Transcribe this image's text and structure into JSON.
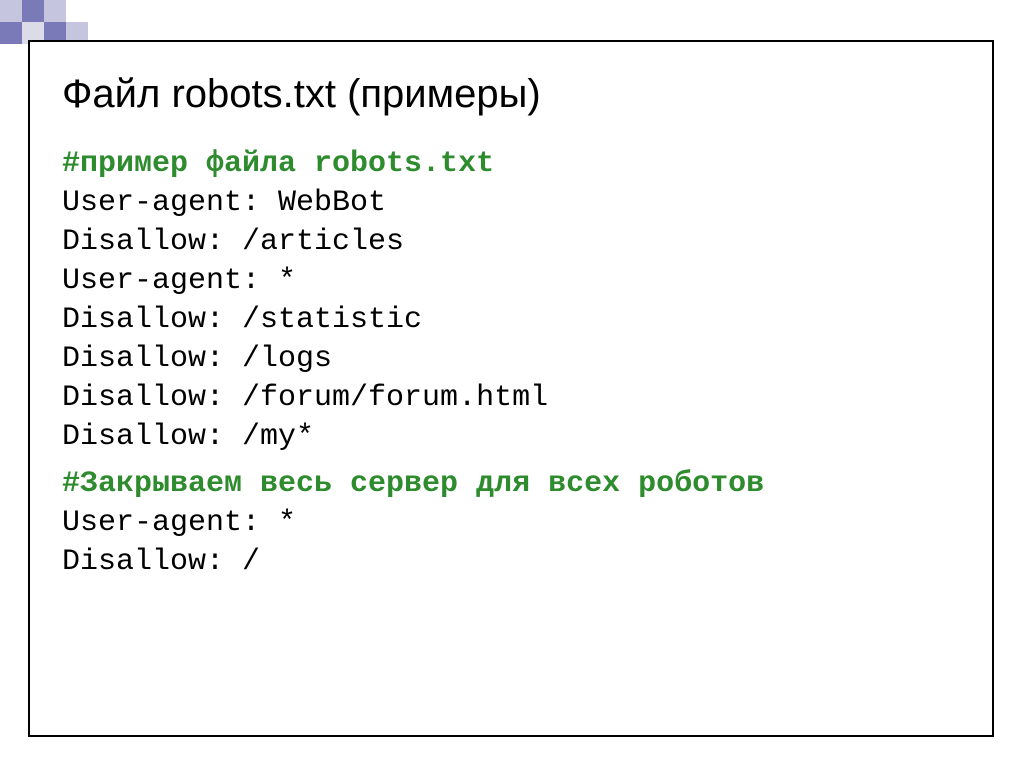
{
  "title": "Файл robots.txt (примеры)",
  "block1": {
    "comment": "#пример файла robots.txt",
    "lines": [
      "User-agent: WebBot",
      "Disallow: /articles",
      "User-agent: *",
      "Disallow: /statistic",
      "Disallow: /logs",
      "Disallow: /forum/forum.html",
      "Disallow: /my*"
    ]
  },
  "block2": {
    "comment": "#Закрываем весь сервер для всех роботов",
    "lines": [
      "User-agent: *",
      "Disallow: /"
    ]
  }
}
